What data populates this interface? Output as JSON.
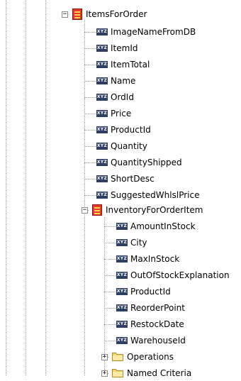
{
  "tree": {
    "root": {
      "label": "ItemsForOrder",
      "icon": "entity-icon",
      "expanded": true,
      "fields": [
        "ImageNameFromDB",
        "ItemId",
        "ItemTotal",
        "Name",
        "OrdId",
        "Price",
        "ProductId",
        "Quantity",
        "QuantityShipped",
        "ShortDesc",
        "SuggestedWhlslPrice"
      ],
      "child": {
        "label": "InventoryForOrderItem",
        "icon": "entity-icon",
        "expanded": true,
        "fields": [
          "AmountInStock",
          "City",
          "MaxInStock",
          "OutOfStockExplanation",
          "ProductId",
          "ReorderPoint",
          "RestockDate",
          "WarehouseId"
        ],
        "folders": [
          {
            "label": "Operations",
            "expanded": false
          },
          {
            "label": "Named Criteria",
            "expanded": false
          }
        ]
      }
    },
    "attribute_icon_text": "XYZ",
    "collapse_glyph": "−",
    "expand_glyph": "+",
    "colors": {
      "entity_red": "#e8392f",
      "entity_yellow": "#ffd84a",
      "attribute_navy": "#2d3f63",
      "folder_yellow": "#f3d97a",
      "connector_gray": "#9a9a9a"
    }
  }
}
